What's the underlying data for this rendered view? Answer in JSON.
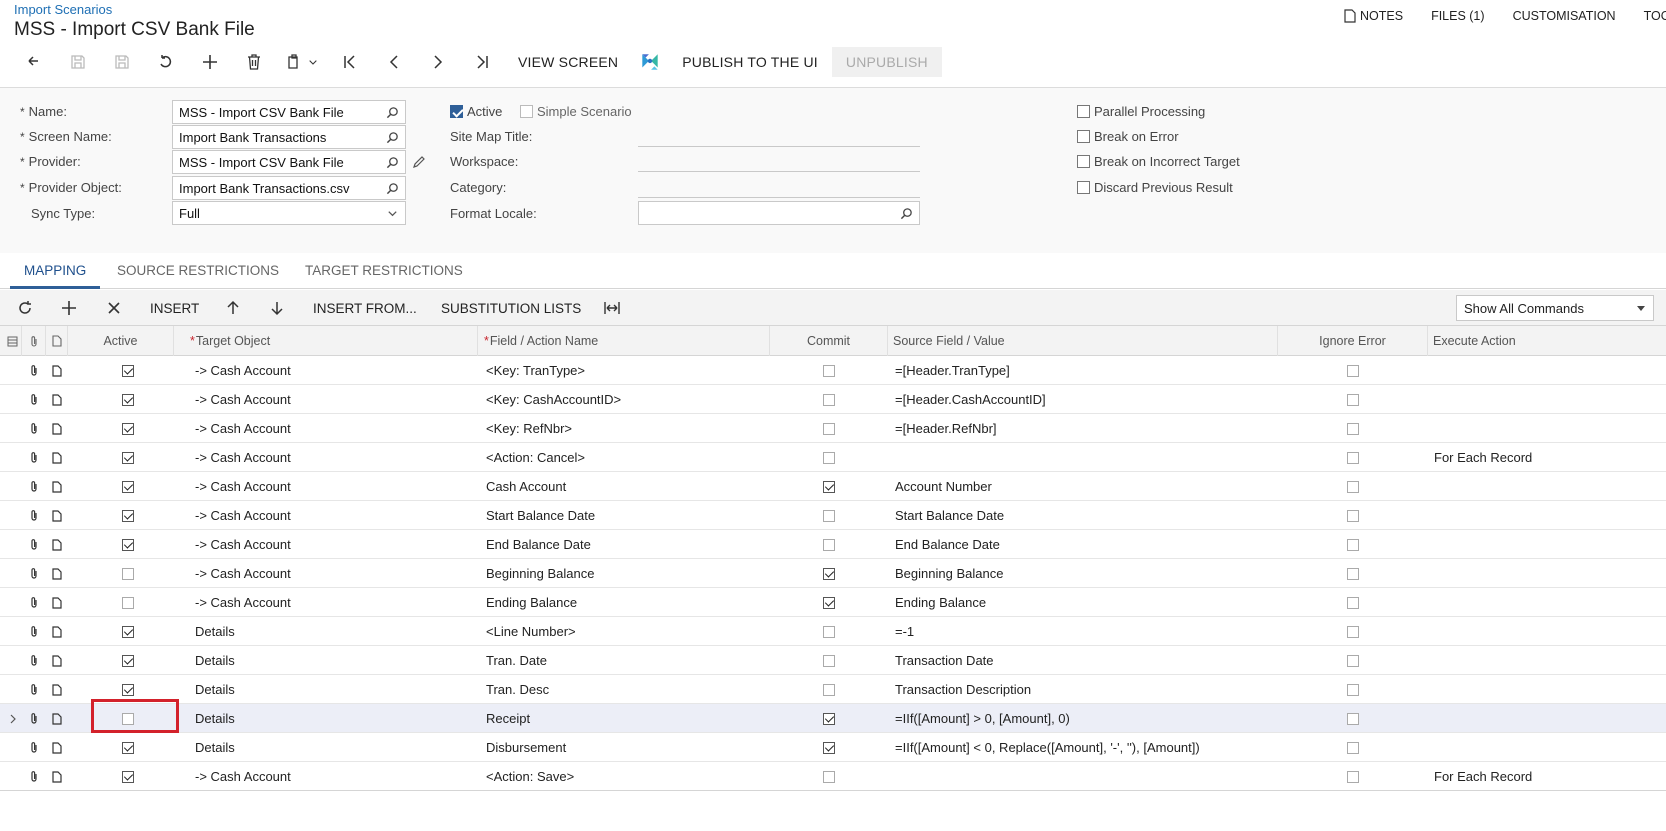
{
  "header": {
    "breadcrumb": "Import Scenarios",
    "title": "MSS - Import CSV Bank File",
    "links": {
      "notes": "NOTES",
      "files": "FILES (1)",
      "customisation": "CUSTOMISATION",
      "tools": "TOO"
    }
  },
  "toolbar": {
    "view_screen": "VIEW SCREEN",
    "publish": "PUBLISH TO THE UI",
    "unpublish": "UNPUBLISH"
  },
  "form": {
    "name_label": "Name:",
    "name_value": "MSS - Import CSV Bank File",
    "screen_label": "Screen Name:",
    "screen_value": "Import Bank Transactions",
    "provider_label": "Provider:",
    "provider_value": "MSS - Import CSV Bank File",
    "provider_obj_label": "Provider Object:",
    "provider_obj_value": "Import Bank Transactions.csv",
    "sync_label": "Sync Type:",
    "sync_value": "Full",
    "active_label": "Active",
    "simple_label": "Simple Scenario",
    "sitemap_label": "Site Map Title:",
    "workspace_label": "Workspace:",
    "category_label": "Category:",
    "locale_label": "Format Locale:",
    "parallel_label": "Parallel Processing",
    "break_error_label": "Break on Error",
    "break_target_label": "Break on Incorrect Target",
    "discard_label": "Discard Previous Result"
  },
  "tabs": {
    "mapping": "MAPPING",
    "source": "SOURCE RESTRICTIONS",
    "target": "TARGET RESTRICTIONS"
  },
  "grid_toolbar": {
    "insert": "INSERT",
    "insert_from": "INSERT FROM...",
    "substitution": "SUBSTITUTION LISTS",
    "commands_select": "Show All Commands"
  },
  "columns": {
    "active": "Active",
    "target_object": "Target Object",
    "field_action": "Field / Action Name",
    "commit": "Commit",
    "source_field": "Source Field / Value",
    "ignore_error": "Ignore Error",
    "execute_action": "Execute Action"
  },
  "rows": [
    {
      "active": true,
      "target": "-> Cash Account",
      "field": "<Key: TranType>",
      "commit": false,
      "source": "=[Header.TranType]",
      "ignore": false,
      "exec": ""
    },
    {
      "active": true,
      "target": "-> Cash Account",
      "field": "<Key: CashAccountID>",
      "commit": false,
      "source": "=[Header.CashAccountID]",
      "ignore": false,
      "exec": ""
    },
    {
      "active": true,
      "target": "-> Cash Account",
      "field": "<Key: RefNbr>",
      "commit": false,
      "source": "=[Header.RefNbr]",
      "ignore": false,
      "exec": ""
    },
    {
      "active": true,
      "target": "-> Cash Account",
      "field": "<Action: Cancel>",
      "commit": false,
      "source": "",
      "ignore": false,
      "exec": "For Each Record"
    },
    {
      "active": true,
      "target": "-> Cash Account",
      "field": "Cash Account",
      "commit": true,
      "source": "Account Number",
      "ignore": false,
      "exec": ""
    },
    {
      "active": true,
      "target": "-> Cash Account",
      "field": "Start Balance Date",
      "commit": false,
      "source": "Start Balance Date",
      "ignore": false,
      "exec": ""
    },
    {
      "active": true,
      "target": "-> Cash Account",
      "field": "End Balance Date",
      "commit": false,
      "source": "End Balance Date",
      "ignore": false,
      "exec": ""
    },
    {
      "active": false,
      "target": "-> Cash Account",
      "field": "Beginning Balance",
      "commit": true,
      "source": "Beginning Balance",
      "ignore": false,
      "exec": ""
    },
    {
      "active": false,
      "target": "-> Cash Account",
      "field": "Ending Balance",
      "commit": true,
      "source": "Ending Balance",
      "ignore": false,
      "exec": ""
    },
    {
      "active": true,
      "target": "Details",
      "field": "<Line Number>",
      "commit": false,
      "source": "=-1",
      "ignore": false,
      "exec": ""
    },
    {
      "active": true,
      "target": "Details",
      "field": "Tran. Date",
      "commit": false,
      "source": "Transaction Date",
      "ignore": false,
      "exec": ""
    },
    {
      "active": true,
      "target": "Details",
      "field": "Tran. Desc",
      "commit": false,
      "source": "Transaction Description",
      "ignore": false,
      "exec": ""
    },
    {
      "active": false,
      "target": "Details",
      "field": "Receipt",
      "commit": true,
      "source": "=IIf([Amount] > 0, [Amount], 0)",
      "ignore": false,
      "exec": "",
      "selected": true
    },
    {
      "active": true,
      "target": "Details",
      "field": "Disbursement",
      "commit": true,
      "source": "=IIf([Amount] < 0, Replace([Amount], '-', ''), [Amount])",
      "ignore": false,
      "exec": ""
    },
    {
      "active": true,
      "target": "-> Cash Account",
      "field": "<Action: Save>",
      "commit": false,
      "source": "",
      "ignore": false,
      "exec": "For Each Record"
    }
  ],
  "colors": {
    "accent": "#2f5f98",
    "link": "#1e6fb4",
    "highlight": "#d3212b",
    "selected_row": "#eceef7"
  },
  "icons": [
    "undo-icon",
    "save-icon",
    "save-close-icon",
    "cancel-icon",
    "add-icon",
    "delete-icon",
    "copy-paste-icon",
    "first-icon",
    "prev-icon",
    "next-icon",
    "last-icon",
    "puzzle-icon",
    "lookup-icon",
    "edit-pencil-icon",
    "dropdown-icon",
    "refresh-icon",
    "close-icon",
    "arrow-up-icon",
    "arrow-down-icon",
    "fit-columns-icon",
    "paperclip-icon",
    "note-icon"
  ]
}
